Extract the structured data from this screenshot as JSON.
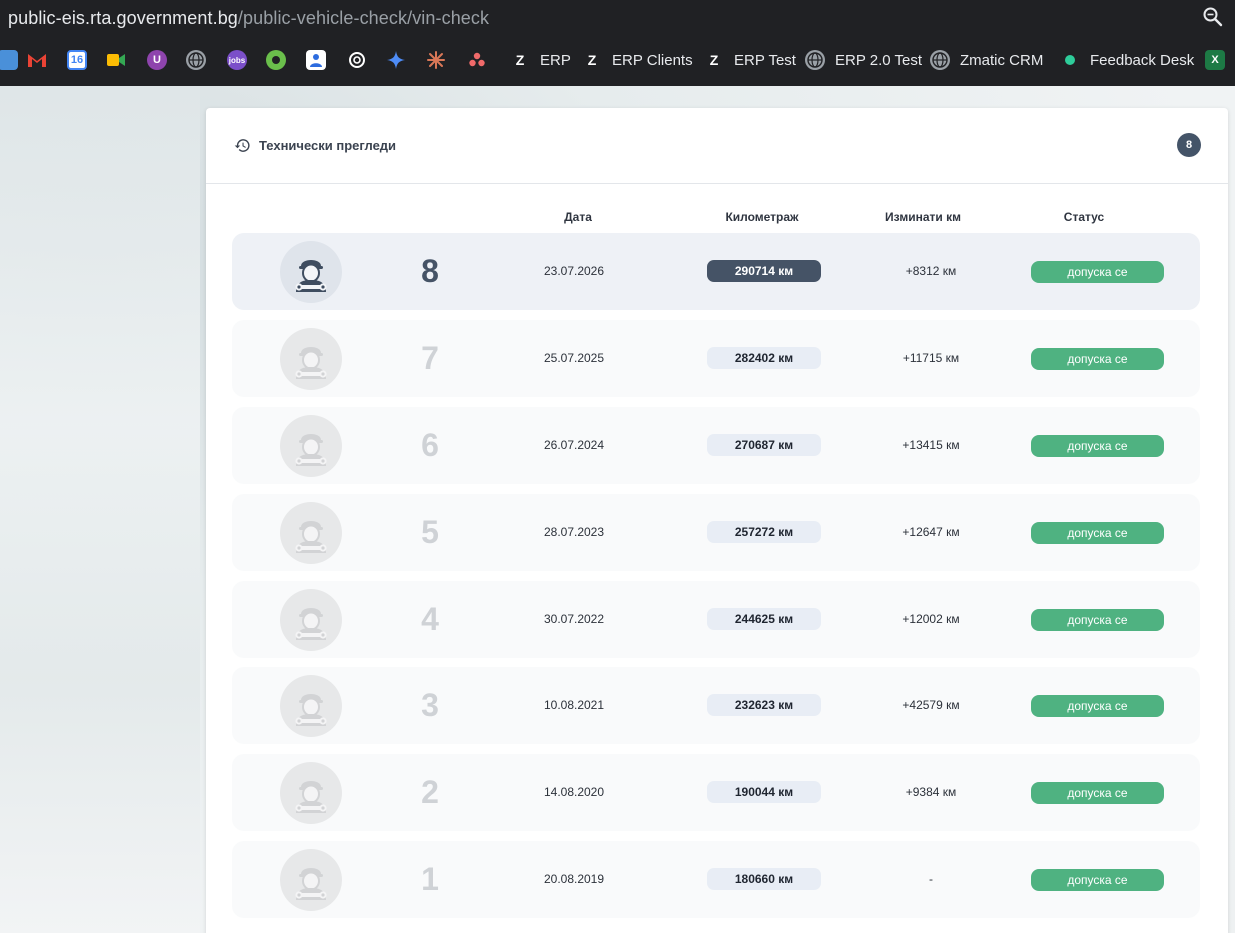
{
  "browser": {
    "url_host": "public-eis.rta.government.bg",
    "url_path": "/public-vehicle-check/vin-check"
  },
  "bookmarks": [
    {
      "icon": "partial-app-icon",
      "label": "",
      "color": "#4a90d9"
    },
    {
      "icon": "gmail-icon",
      "label": "",
      "color": "#ea4335"
    },
    {
      "icon": "google-calendar-icon",
      "label": "",
      "color": "#4285f4"
    },
    {
      "icon": "google-meet-icon",
      "label": "",
      "color": "#fbbc04"
    },
    {
      "icon": "upwork-icon",
      "label": "",
      "color": "#8e44ad"
    },
    {
      "icon": "globe-icon",
      "label": "",
      "color": "#9aa0a6"
    },
    {
      "icon": "jobs-icon",
      "label": "",
      "color": "#7b4fc9"
    },
    {
      "icon": "compass-app-icon",
      "label": "",
      "color": "#6abf4b"
    },
    {
      "icon": "profile-app-icon",
      "label": "",
      "color": "#2d6cdf"
    },
    {
      "icon": "openai-icon",
      "label": "",
      "color": "#ffffff"
    },
    {
      "icon": "gemini-icon",
      "label": "",
      "color": "#4e8cf6"
    },
    {
      "icon": "claude-icon",
      "label": "",
      "color": "#d97757"
    },
    {
      "icon": "asana-icon",
      "label": "",
      "color": "#f06a6a"
    },
    {
      "icon": "zmatic-icon",
      "label": "ERP",
      "color": "#ffffff"
    },
    {
      "icon": "zmatic-icon",
      "label": "ERP Clients",
      "color": "#ffffff"
    },
    {
      "icon": "zmatic-icon",
      "label": "ERP Test",
      "color": "#ffffff"
    },
    {
      "icon": "globe-icon",
      "label": "ERP 2.0 Test",
      "color": "#9aa0a6"
    },
    {
      "icon": "globe-icon",
      "label": "Zmatic CRM",
      "color": "#9aa0a6"
    },
    {
      "icon": "green-dot-icon",
      "label": "Feedback Desk",
      "color": "#2ecc9a"
    },
    {
      "icon": "excel-icon",
      "label": "",
      "color": "#1d7a45"
    }
  ],
  "card": {
    "title": "Технически прегледи",
    "count": "8"
  },
  "columns": {
    "date": "Дата",
    "mileage": "Километраж",
    "km_driven": "Изминати км",
    "status": "Статус"
  },
  "inspections": [
    {
      "num": "8",
      "date": "23.07.2026",
      "km": "290714 км",
      "diff": "+8312 км",
      "status": "допуска се",
      "active": true
    },
    {
      "num": "7",
      "date": "25.07.2025",
      "km": "282402 км",
      "diff": "+11715 км",
      "status": "допуска се",
      "active": false
    },
    {
      "num": "6",
      "date": "26.07.2024",
      "km": "270687 км",
      "diff": "+13415 км",
      "status": "допуска се",
      "active": false
    },
    {
      "num": "5",
      "date": "28.07.2023",
      "km": "257272 км",
      "diff": "+12647 км",
      "status": "допуска се",
      "active": false
    },
    {
      "num": "4",
      "date": "30.07.2022",
      "km": "244625 км",
      "diff": "+12002 км",
      "status": "допуска се",
      "active": false
    },
    {
      "num": "3",
      "date": "10.08.2021",
      "km": "232623 км",
      "diff": "+42579 км",
      "status": "допуска се",
      "active": false
    },
    {
      "num": "2",
      "date": "14.08.2020",
      "km": "190044 км",
      "diff": "+9384 км",
      "status": "допуска се",
      "active": false
    },
    {
      "num": "1",
      "date": "20.08.2019",
      "km": "180660 км",
      "diff": "-",
      "status": "допуска се",
      "active": false
    }
  ],
  "colors": {
    "accent_dark": "#455366",
    "status_green": "#4fb281",
    "km_pill": "#e8edf5"
  }
}
